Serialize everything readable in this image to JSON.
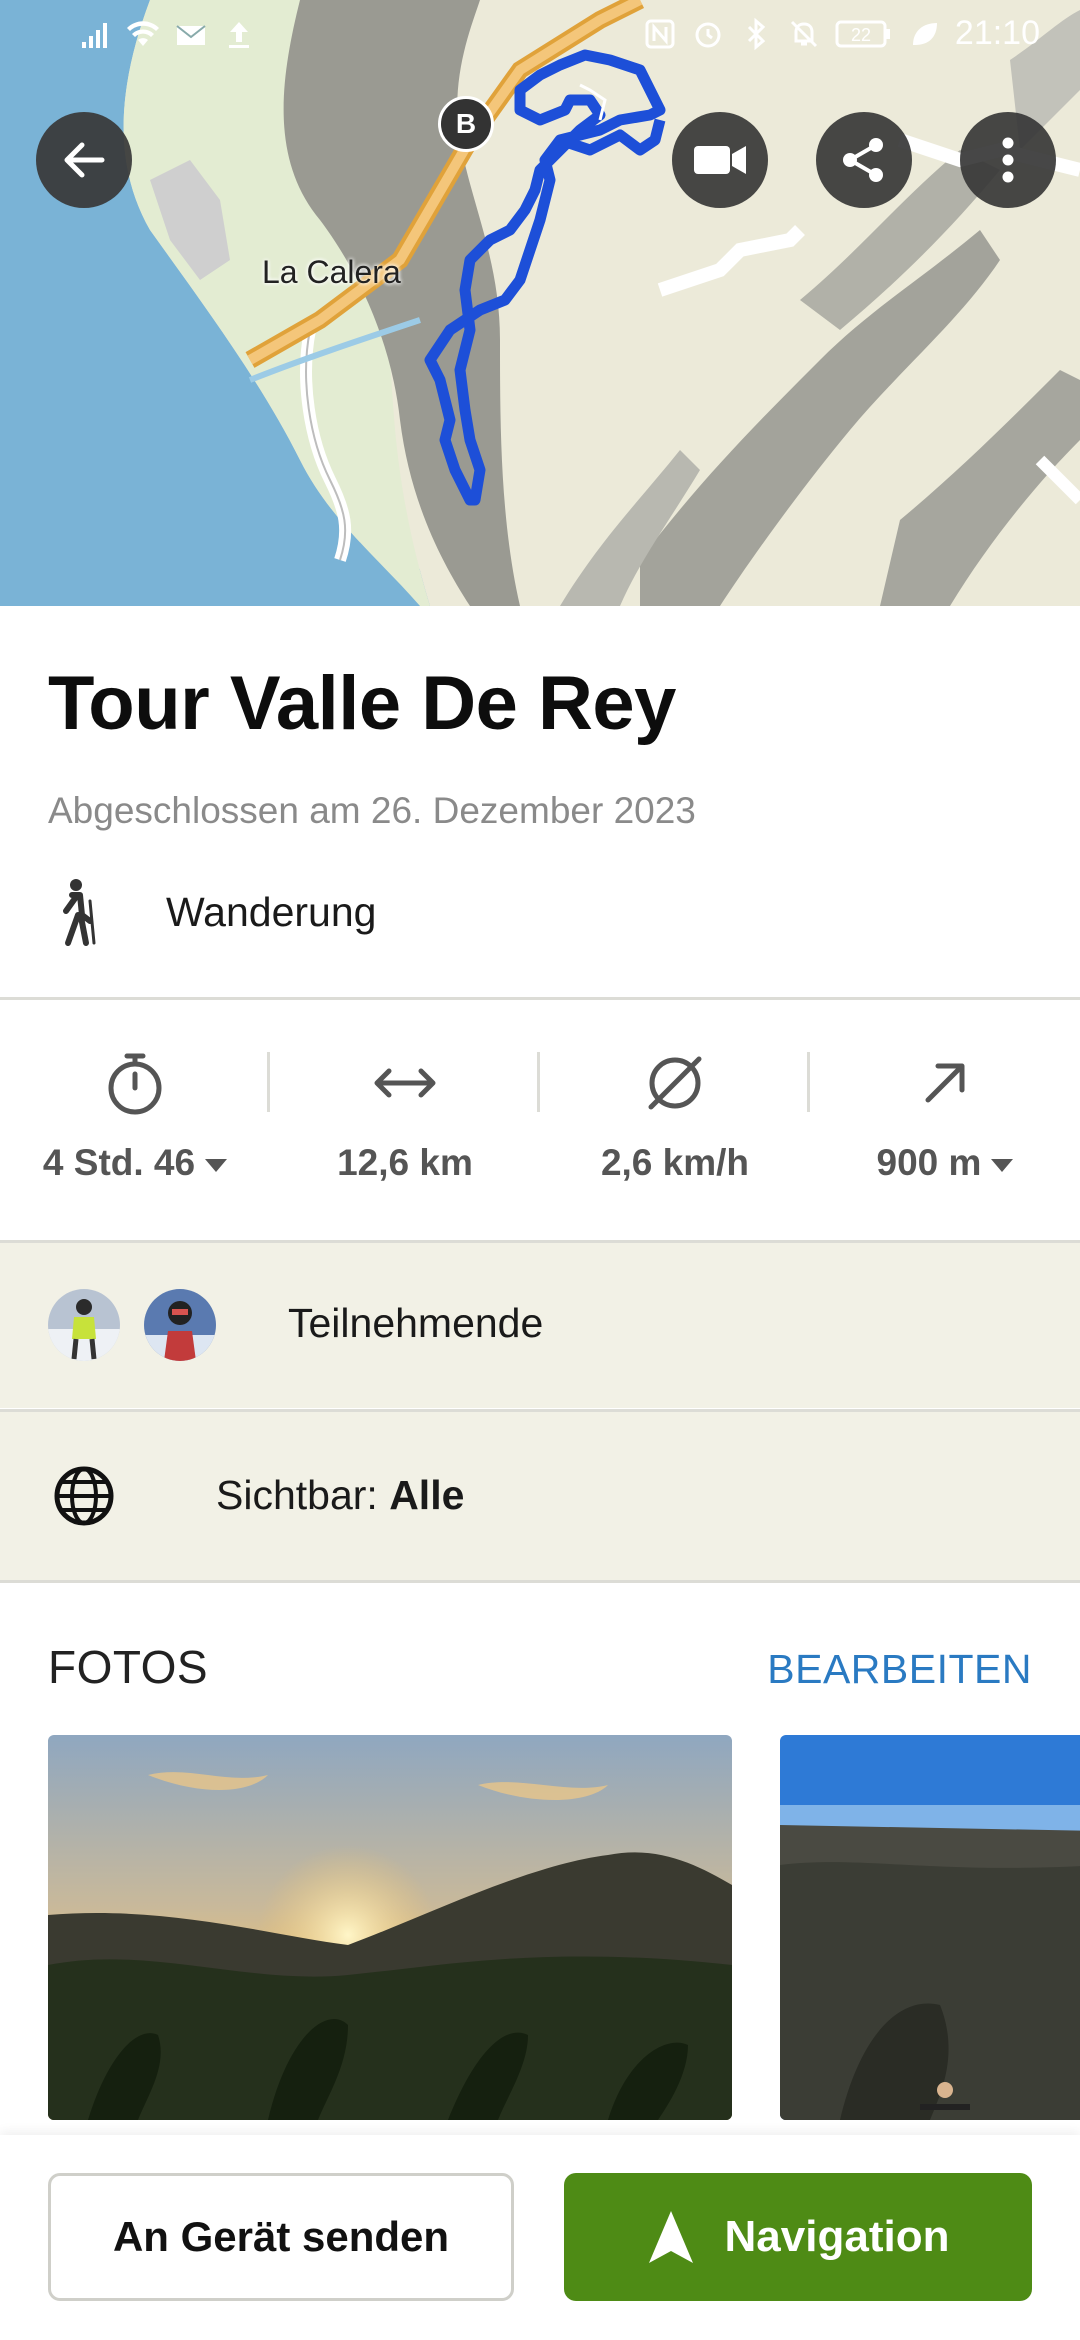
{
  "status_bar": {
    "time": "21:10",
    "battery": "22"
  },
  "map": {
    "town_label": "La Calera",
    "marker_label": "B",
    "route_color": "#1d4fd8"
  },
  "tour": {
    "title": "Tour Valle De Rey",
    "completed": "Abgeschlossen am 26. Dezember 2023",
    "activity": "Wanderung"
  },
  "stats": [
    {
      "icon": "stopwatch-icon",
      "value": "4 Std. 46",
      "has_dropdown": true
    },
    {
      "icon": "distance-arrows-icon",
      "value": "12,6 km",
      "has_dropdown": false
    },
    {
      "icon": "average-speed-icon",
      "value": "2,6 km/h",
      "has_dropdown": false
    },
    {
      "icon": "elevation-up-icon",
      "value": "900 m",
      "has_dropdown": true
    }
  ],
  "participants": {
    "label": "Teilnehmende"
  },
  "visibility": {
    "prefix": "Sichtbar: ",
    "value": "Alle"
  },
  "photos": {
    "heading": "FOTOS",
    "edit_label": "BEARBEITEN"
  },
  "actions": {
    "send_label": "An Gerät senden",
    "navigation_label": "Navigation"
  },
  "colors": {
    "accent_green": "#4e8b15",
    "link_blue": "#2a7ac2",
    "beige": "#f2f1e6"
  }
}
